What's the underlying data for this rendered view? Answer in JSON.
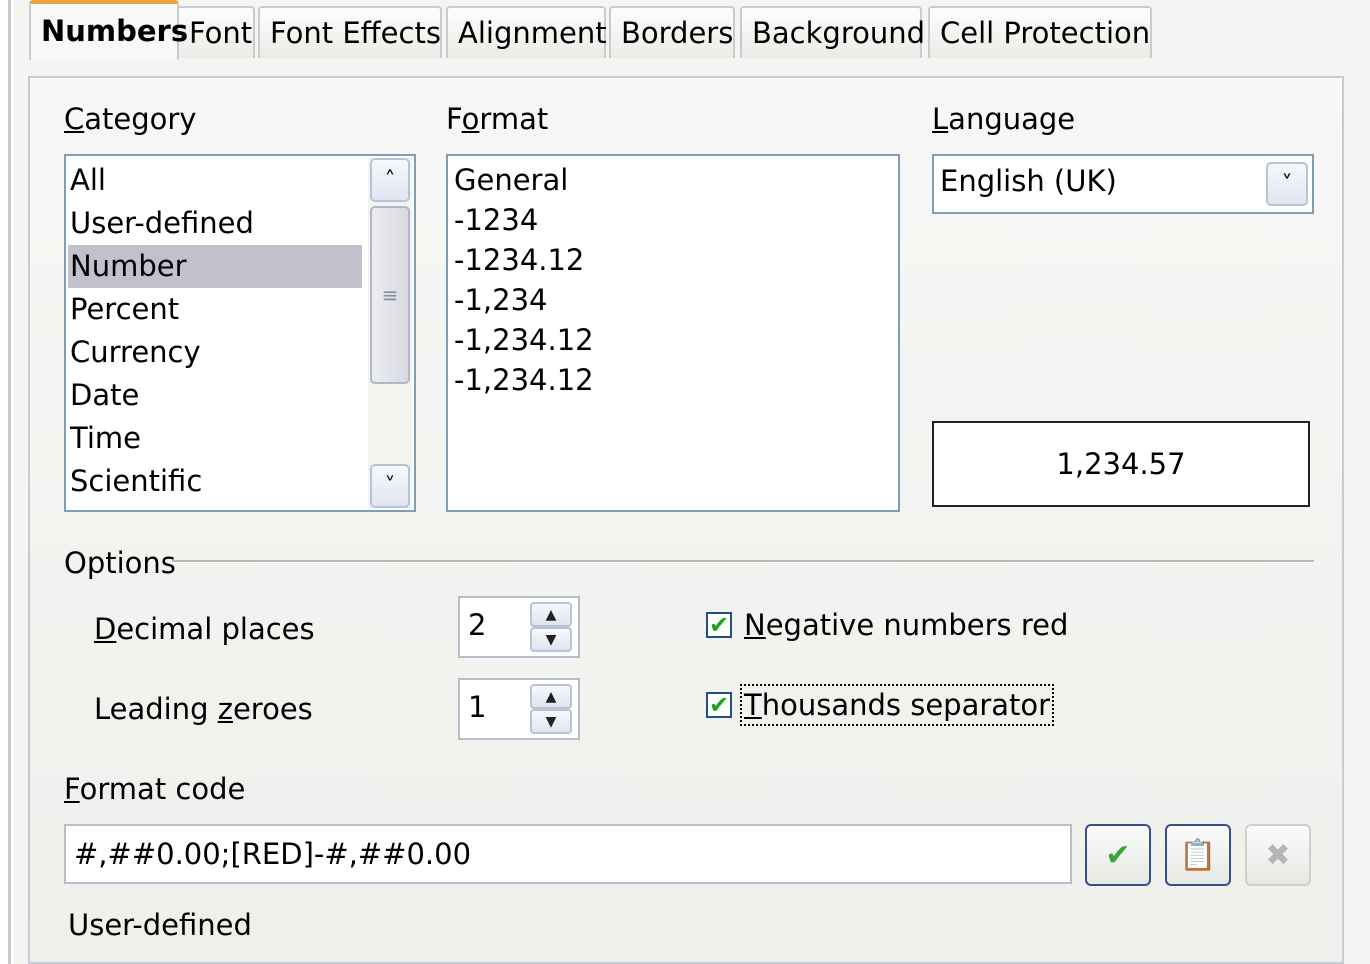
{
  "tabs": [
    {
      "label": "Numbers",
      "active": true
    },
    {
      "label": "Font",
      "active": false
    },
    {
      "label": "Font Effects",
      "active": false
    },
    {
      "label": "Alignment",
      "active": false
    },
    {
      "label": "Borders",
      "active": false
    },
    {
      "label": "Background",
      "active": false
    },
    {
      "label": "Cell Protection",
      "active": false
    }
  ],
  "category": {
    "label_u": "C",
    "label_rest": "ategory",
    "items": [
      "All",
      "User-defined",
      "Number",
      "Percent",
      "Currency",
      "Date",
      "Time",
      "Scientific"
    ],
    "selected": "Number"
  },
  "format": {
    "label_pre": "F",
    "label_u": "o",
    "label_rest": "rmat",
    "items": [
      "General",
      "-1234",
      "-1234.12",
      "-1,234",
      "-1,234.12",
      "-1,234.12"
    ]
  },
  "language": {
    "label_u": "L",
    "label_rest": "anguage",
    "value": "English (UK)"
  },
  "preview": "1,234.57",
  "options": {
    "title": "Options",
    "decimal_label_u": "D",
    "decimal_label_rest": "ecimal places",
    "decimal_value": "2",
    "leading_label_pre": "Leading ",
    "leading_label_u": "z",
    "leading_label_rest": "eroes",
    "leading_value": "1",
    "negative_red_u": "N",
    "negative_red_rest": "egative numbers red",
    "negative_red_checked": true,
    "thousands_u": "T",
    "thousands_rest": "housands separator",
    "thousands_checked": true
  },
  "format_code": {
    "label_u": "F",
    "label_rest": "ormat code",
    "value": "#,##0.00;[RED]-#,##0.00",
    "description": "User-defined"
  },
  "icons": {
    "accept": "checkmark-icon",
    "edit": "edit-comment-icon",
    "delete": "delete-icon"
  },
  "colors": {
    "tab_accent": "#e8a33a",
    "selection": "#c0c1cc",
    "check": "#21a121"
  }
}
